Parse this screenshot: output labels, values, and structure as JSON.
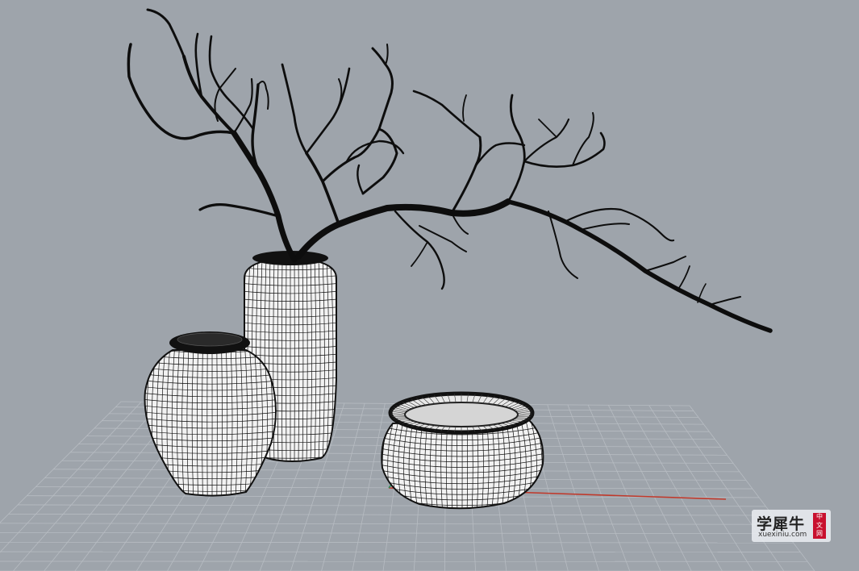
{
  "viewport": {
    "background": "#9ea4ab",
    "grid_color": "#b7bcc2",
    "x_axis_color": "#c0392b",
    "y_axis_color": "#2e8b57",
    "mesh_color": "#111111",
    "object_fill": "#f2f2f2"
  },
  "scene": {
    "objects": [
      "bottle-vase",
      "jar-vase",
      "round-bowl",
      "branch"
    ],
    "render_mode": "wireframe-mesh"
  },
  "watermark": {
    "logo": "学犀牛",
    "url": "xuexiniu.com",
    "badge": [
      "中",
      "文",
      "网"
    ]
  }
}
